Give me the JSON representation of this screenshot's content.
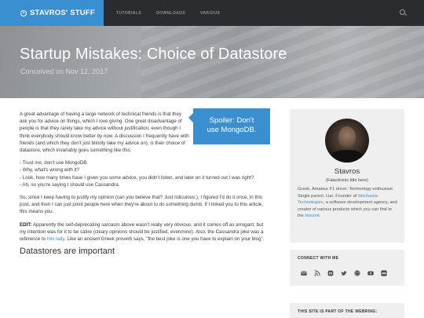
{
  "nav": {
    "brand": "STAVROS' STUFF",
    "links": [
      "TUTORIALS",
      "DOWNLOADS",
      "VARIOUS"
    ]
  },
  "hero": {
    "title": "Startup Mistakes: Choice of Datastore",
    "date": "Conceived on Nov 12, 2017"
  },
  "spoiler": {
    "line1": "Spoiler: Don't",
    "line2": "use MongoDB."
  },
  "article": {
    "intro": "A great advantage of having a large network of technical friends is that they ask you for advice on things, which I love giving. One great disadvantage of people is that they rarely take my advice without justification, even though I think everybody should know better by now. A discussion I frequently have with friends (and which they don't just blindly take my advice on), is their choice of datastore, which invariably goes something like this:",
    "dialog": [
      "- Trust me, don't use MongoDB.",
      "- Why, what's wrong with it?",
      "- Look, how many times have I given you some advice, you didn't listen, and later on it turned out I was right?",
      "- Ah, so you're saying I should use Cassandra."
    ],
    "para2": "So, since I keep having to justify my opinion (can you believe that? Just ridiculous.), I figured I'd do it once, in this post, and then I can just point people here when they're about to do something dumb. If I linked you to this article, this means you.",
    "edit_label": "EDIT:",
    "edit_text_1": " Apparently the self-deprecating sarcasm above wasn't really very obvious, and it comes off as arrogant, but my intention was for it to be satire (cleary opinions should be justified, evenmine). Also, the Cassandra joke was a reference to ",
    "edit_link": "this lady",
    "edit_text_2": ". Like an ancient Greek proverb says, \"the best joke is one you have to explain on your blog\".",
    "heading": "Datastores are important"
  },
  "sidebar": {
    "name": "Stavros",
    "subtitle": "(Fake/ironic title here)",
    "bio_1": "Greek. Amateur F1 driver. Technology enthusiast. Single parent. Liar. Founder of ",
    "bio_link": "Stochastic Technologies",
    "bio_2": ", a software development agency, and creator of various products which you can find in the ",
    "bio_link2": "résumé",
    "bio_3": ".",
    "connect_heading": "CONNECT WITH ME",
    "connect_icons": [
      "email-icon",
      "rss-icon",
      "mastodon-icon",
      "twitter-icon",
      "github-icon",
      "youtube-icon",
      "flickr-icon"
    ],
    "webring_heading": "THIS SITE IS PART OF THE WEBRING:"
  },
  "colors": {
    "accent": "#3a8fd0",
    "nav_bg": "#2a2c2f"
  }
}
